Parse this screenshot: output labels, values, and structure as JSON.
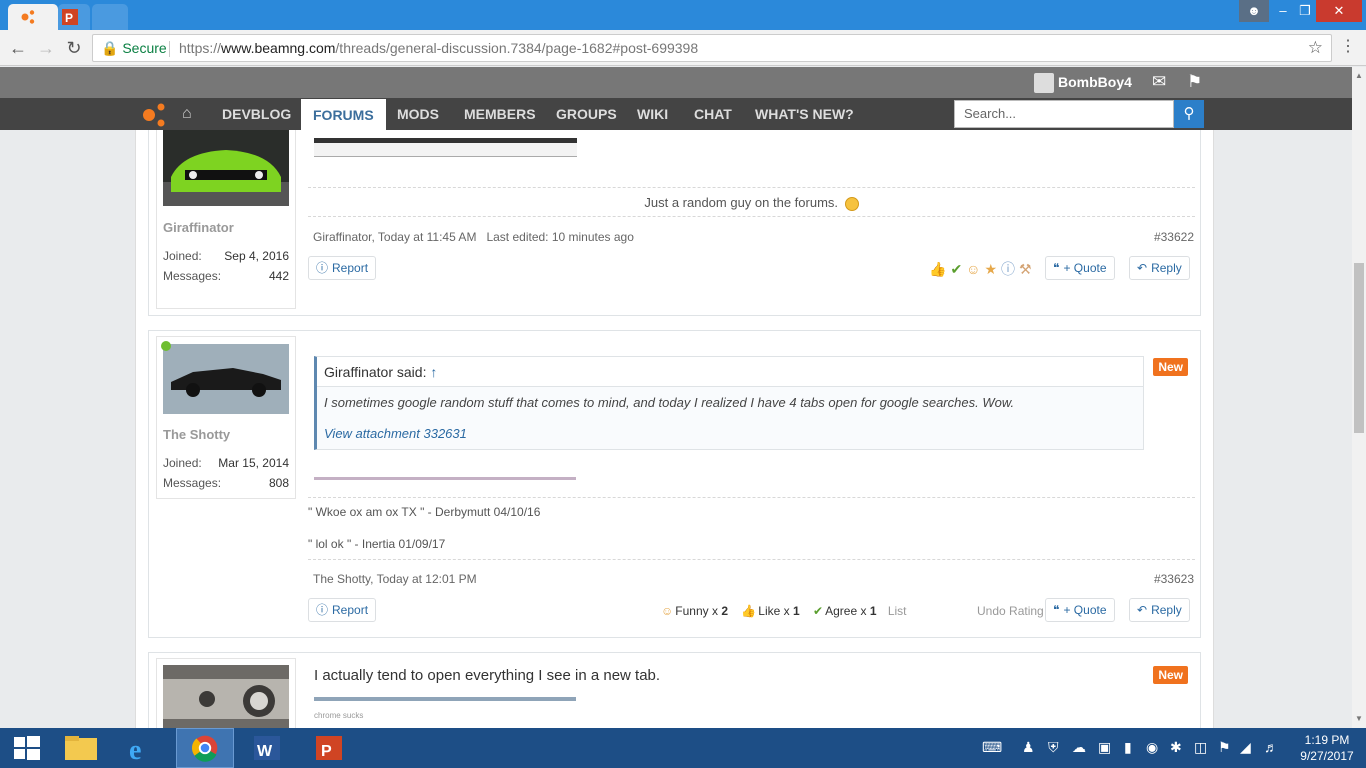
{
  "browser": {
    "tabs": [
      {
        "title": ""
      },
      {
        "title": ""
      },
      {
        "title": ""
      }
    ],
    "secure_label": "Secure",
    "url_scheme": "https://",
    "url_host": "www.beamng.com",
    "url_path": "/threads/general-discussion.7384/page-1682#post-699398"
  },
  "site": {
    "username": "BombBoy4",
    "nav": [
      "DEVBLOG",
      "FORUMS",
      "MODS",
      "MEMBERS",
      "GROUPS",
      "WIKI",
      "CHAT",
      "WHAT'S NEW?"
    ],
    "search_placeholder": "Search..."
  },
  "posts": [
    {
      "author": "Giraffinator",
      "joined_label": "Joined:",
      "joined": "Sep 4, 2016",
      "messages_label": "Messages:",
      "messages": "442",
      "signature": "Just a random guy on the forums.",
      "meta": "Giraffinator, Today at 11:45 AM",
      "edited": "Last edited: 10 minutes ago",
      "number": "#33622",
      "report": "Report",
      "quote": "+ Quote",
      "reply": "Reply"
    },
    {
      "author": "The Shotty",
      "joined_label": "Joined:",
      "joined": "Mar 15, 2014",
      "messages_label": "Messages:",
      "messages": "808",
      "badge": "New",
      "quote_author": "Giraffinator said:",
      "quote_arrow": "↑",
      "quote_text": "I sometimes google random stuff that comes to mind, and today I realized I have 4 tabs open for google searches. Wow.",
      "quote_link": "View attachment 332631",
      "sig_line1": "\" Wkoe ox am ox TX \" - Derbymutt 04/10/16",
      "sig_line2": "\" lol ok \" - Inertia 01/09/17",
      "meta": "The Shotty, Today at 12:01 PM",
      "number": "#33623",
      "report": "Report",
      "ratings": [
        {
          "label": "Funny",
          "mult": "x",
          "count": "2"
        },
        {
          "label": "Like",
          "mult": "x",
          "count": "1"
        },
        {
          "label": "Agree",
          "mult": "x",
          "count": "1"
        }
      ],
      "list_label": "List",
      "undo": "Undo Rating",
      "quote": "+ Quote",
      "reply": "Reply"
    },
    {
      "badge": "New",
      "message": "I actually tend to open everything I see in a new tab.",
      "attach_caption": "chrome sucks"
    }
  ],
  "taskbar": {
    "time": "1:19 PM",
    "date": "9/27/2017"
  },
  "colors": {
    "accent": "#2c7fc9",
    "new_badge": "#f0721e",
    "navbar": "#444444",
    "userbar": "#777777",
    "taskbar": "#1d4e86"
  }
}
